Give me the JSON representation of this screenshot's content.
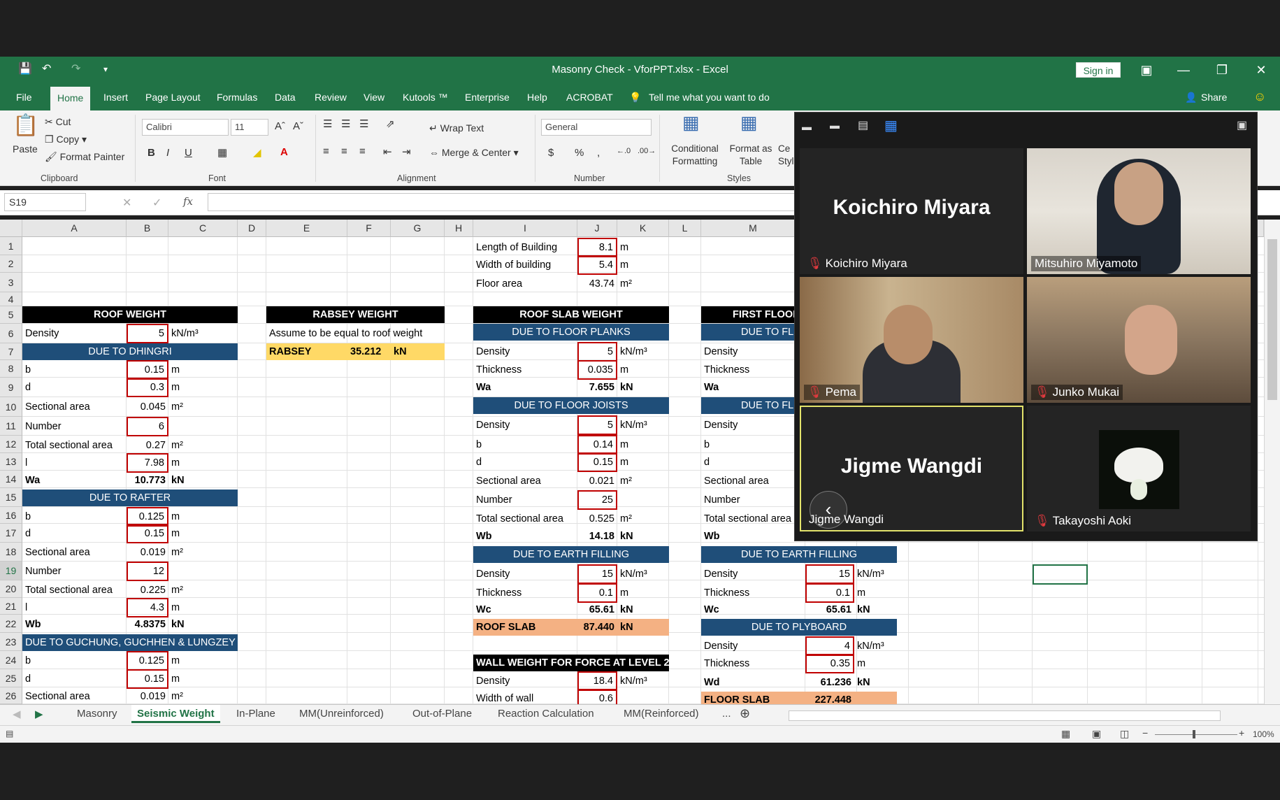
{
  "window": {
    "title": "Masonry Check - VforPPT.xlsx  -  Excel",
    "sign_in": "Sign in",
    "share": "Share"
  },
  "menu_tabs": [
    "File",
    "Home",
    "Insert",
    "Page Layout",
    "Formulas",
    "Data",
    "Review",
    "View",
    "Kutools ™",
    "Enterprise",
    "Help",
    "ACROBAT"
  ],
  "tell_me": "Tell me what you want to do",
  "ribbon": {
    "clipboard": {
      "paste": "Paste",
      "cut": "Cut",
      "copy": "Copy",
      "format_painter": "Format Painter",
      "label": "Clipboard"
    },
    "font": {
      "name": "Calibri",
      "size": "11",
      "label": "Font",
      "bold": "B",
      "italic": "I",
      "underline": "U"
    },
    "alignment": {
      "wrap_text": "Wrap Text",
      "merge_center": "Merge & Center",
      "label": "Alignment"
    },
    "number": {
      "format": "General",
      "currency": "$",
      "percent": "%",
      "comma": ",",
      "label": "Number"
    },
    "styles": {
      "conditional": "Conditional",
      "conditional2": "Formatting",
      "format_as": "Format as",
      "format_as2": "Table",
      "cell_styles": "Ce",
      "cell_styles2": "Styl",
      "label": "Styles"
    }
  },
  "name_box": "S19",
  "fx": "fx",
  "columns": [
    "A",
    "B",
    "C",
    "D",
    "E",
    "F",
    "G",
    "H",
    "I",
    "J",
    "K",
    "L",
    "M"
  ],
  "rows": [
    "1",
    "2",
    "3",
    "4",
    "5",
    "6",
    "7",
    "8",
    "9",
    "10",
    "11",
    "12",
    "13",
    "14",
    "15",
    "16",
    "17",
    "18",
    "19",
    "20",
    "21",
    "22",
    "23",
    "24",
    "25",
    "26"
  ],
  "roof_weight": {
    "header": "ROOF WEIGHT",
    "density": {
      "label": "Density",
      "value": "5",
      "unit": "kN/m³"
    },
    "dhingri": {
      "header": "DUE TO DHINGRI",
      "b": "0.15",
      "d": "0.3",
      "sec": "0.045",
      "number": "6",
      "total": "0.27",
      "l": "7.98",
      "wa": "10.773"
    },
    "rafter": {
      "header": "DUE TO RAFTER",
      "b": "0.125",
      "d": "0.15",
      "sec": "0.019",
      "number": "12",
      "total": "0.225",
      "l": "4.3",
      "wb": "4.8375"
    },
    "guchung": {
      "header": "DUE TO GUCHUNG, GUCHHEN & LUNGZEY",
      "b": "0.125",
      "d": "0.15",
      "sec": "0.019"
    }
  },
  "labels": {
    "b": "b",
    "d": "d",
    "l": "l",
    "sectional_area": "Sectional area",
    "number": "Number",
    "total_sectional_area": "Total sectional area",
    "wa": "Wa",
    "wb": "Wb",
    "wc": "Wc",
    "wd": "Wd",
    "density": "Density",
    "thickness": "Thickness",
    "m": "m",
    "m2": "m²",
    "kn": "kN",
    "knm3": "kN/m³"
  },
  "rabsey": {
    "header": "RABSEY WEIGHT",
    "note": "Assume to be equal to roof weight",
    "label": "RABSEY",
    "value": "35.212",
    "unit": "kN"
  },
  "building": {
    "length_label": "Length of Building",
    "length": "8.1",
    "width_label": "Width of building",
    "width": "5.4",
    "area_label": "Floor area",
    "area": "43.74"
  },
  "roof_slab": {
    "header": "ROOF SLAB WEIGHT",
    "planks": {
      "header": "DUE TO FLOOR PLANKS",
      "density": "5",
      "thickness": "0.035",
      "wa": "7.655"
    },
    "joists": {
      "header": "DUE TO FLOOR JOISTS",
      "density": "5",
      "b": "0.14",
      "d": "0.15",
      "sec": "0.021",
      "number": "25",
      "total": "0.525",
      "wb": "14.18"
    },
    "earth": {
      "header": "DUE TO EARTH FILLING",
      "density": "15",
      "thickness": "0.1",
      "wc": "65.61"
    },
    "total_label": "ROOF SLAB",
    "total": "87.440"
  },
  "wall": {
    "header": "WALL WEIGHT FOR FORCE AT LEVEL 2",
    "density": "18.4",
    "width_label": "Width of wall",
    "width": "0.6"
  },
  "first_floor": {
    "header": "FIRST FLOOR",
    "planks_header": "DUE TO FL",
    "joists_header": "DUE TO FL",
    "earth": {
      "header": "DUE TO EARTH FILLING",
      "density": "15",
      "thickness": "0.1",
      "wc": "65.61"
    },
    "plyboard": {
      "header": "DUE TO PLYBOARD",
      "density": "4",
      "thickness": "0.35",
      "wd": "61.236"
    },
    "total_label": "FLOOR SLAB",
    "total": "227.448"
  },
  "sheet_tabs": [
    "Masonry",
    "Seismic Weight",
    "In-Plane",
    "MM(Unreinforced)",
    "Out-of-Plane",
    "Reaction Calculation",
    "MM(Reinforced)",
    "..."
  ],
  "status": {
    "zoom": "100%"
  },
  "zoom_call": {
    "participants": [
      {
        "name": "Koichiro Miyara",
        "big": "Koichiro Miyara",
        "muted": true
      },
      {
        "name": "Mitsuhiro Miyamoto",
        "big": "",
        "muted": false
      },
      {
        "name": "Pema",
        "big": "",
        "muted": true
      },
      {
        "name": "Junko Mukai",
        "big": "",
        "muted": true
      },
      {
        "name": "Jigme Wangdi",
        "big": "Jigme Wangdi",
        "muted": false
      },
      {
        "name": "Takayoshi Aoki",
        "big": "",
        "muted": true
      }
    ],
    "colors": {
      "active_border": "#e3e36b",
      "mute": "#e0393e"
    }
  },
  "colors": {
    "excel_green": "#217346",
    "header_blue": "#1f4e79",
    "highlight_yellow": "#ffd966",
    "highlight_orange": "#f4b183",
    "input_box": "#c00000"
  }
}
